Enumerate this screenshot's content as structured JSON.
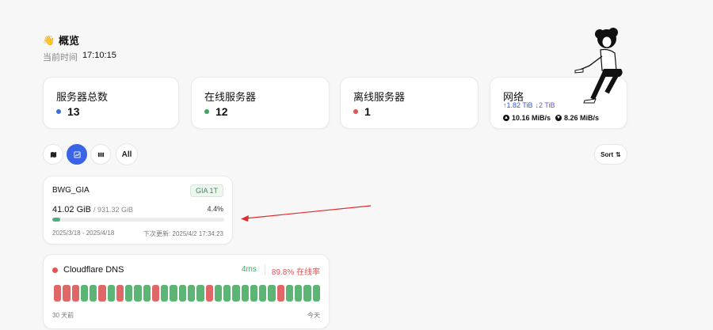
{
  "header": {
    "wave_icon": "👋",
    "title": "概览",
    "time_label": "当前时间",
    "time_value": "17:10:15"
  },
  "stats": {
    "total": {
      "label": "服务器总数",
      "value": "13",
      "color": "#3b6fe0"
    },
    "online": {
      "label": "在线服务器",
      "value": "12",
      "color": "#3ea663"
    },
    "offline": {
      "label": "离线服务器",
      "value": "1",
      "color": "#e05454"
    },
    "network": {
      "label": "网络",
      "up_traffic": "↑1.82 TiB",
      "down_traffic": "↓2 TiB",
      "up_speed": "10.16 MiB/s",
      "down_speed": "8.26 MiB/s"
    }
  },
  "toolbar": {
    "map_icon": "map-icon",
    "chart_icon": "chart-icon",
    "grid_icon": "columns-icon",
    "all_label": "All",
    "sort_label": "Sort",
    "sort_icon": "⇅",
    "active_color": "#3b63e6"
  },
  "service": {
    "name": "BWG_GIA",
    "tag": "GIA 1T",
    "used": "41.02 GiB",
    "total": "/ 931.32 GiB",
    "percent_text": "4.4%",
    "percent_value": 4.4,
    "period": "2025/3/18 - 2025/4/18",
    "next_update": "下次更新: 2025/4/2 17:34:23",
    "bar_color": "#4caf7d"
  },
  "monitor": {
    "name": "Cloudflare DNS",
    "status_color": "#e05454",
    "latency": "4ms",
    "uptime": "89.8% 在线率",
    "from_label": "30 天前",
    "to_label": "今天",
    "bar_colors": {
      "up": "#5cb574",
      "down": "#e06767"
    },
    "days": [
      0,
      0,
      0,
      1,
      1,
      0,
      1,
      0,
      1,
      1,
      1,
      0,
      1,
      1,
      1,
      1,
      1,
      0,
      1,
      1,
      1,
      1,
      1,
      1,
      1,
      0,
      1,
      1,
      1,
      1
    ]
  }
}
